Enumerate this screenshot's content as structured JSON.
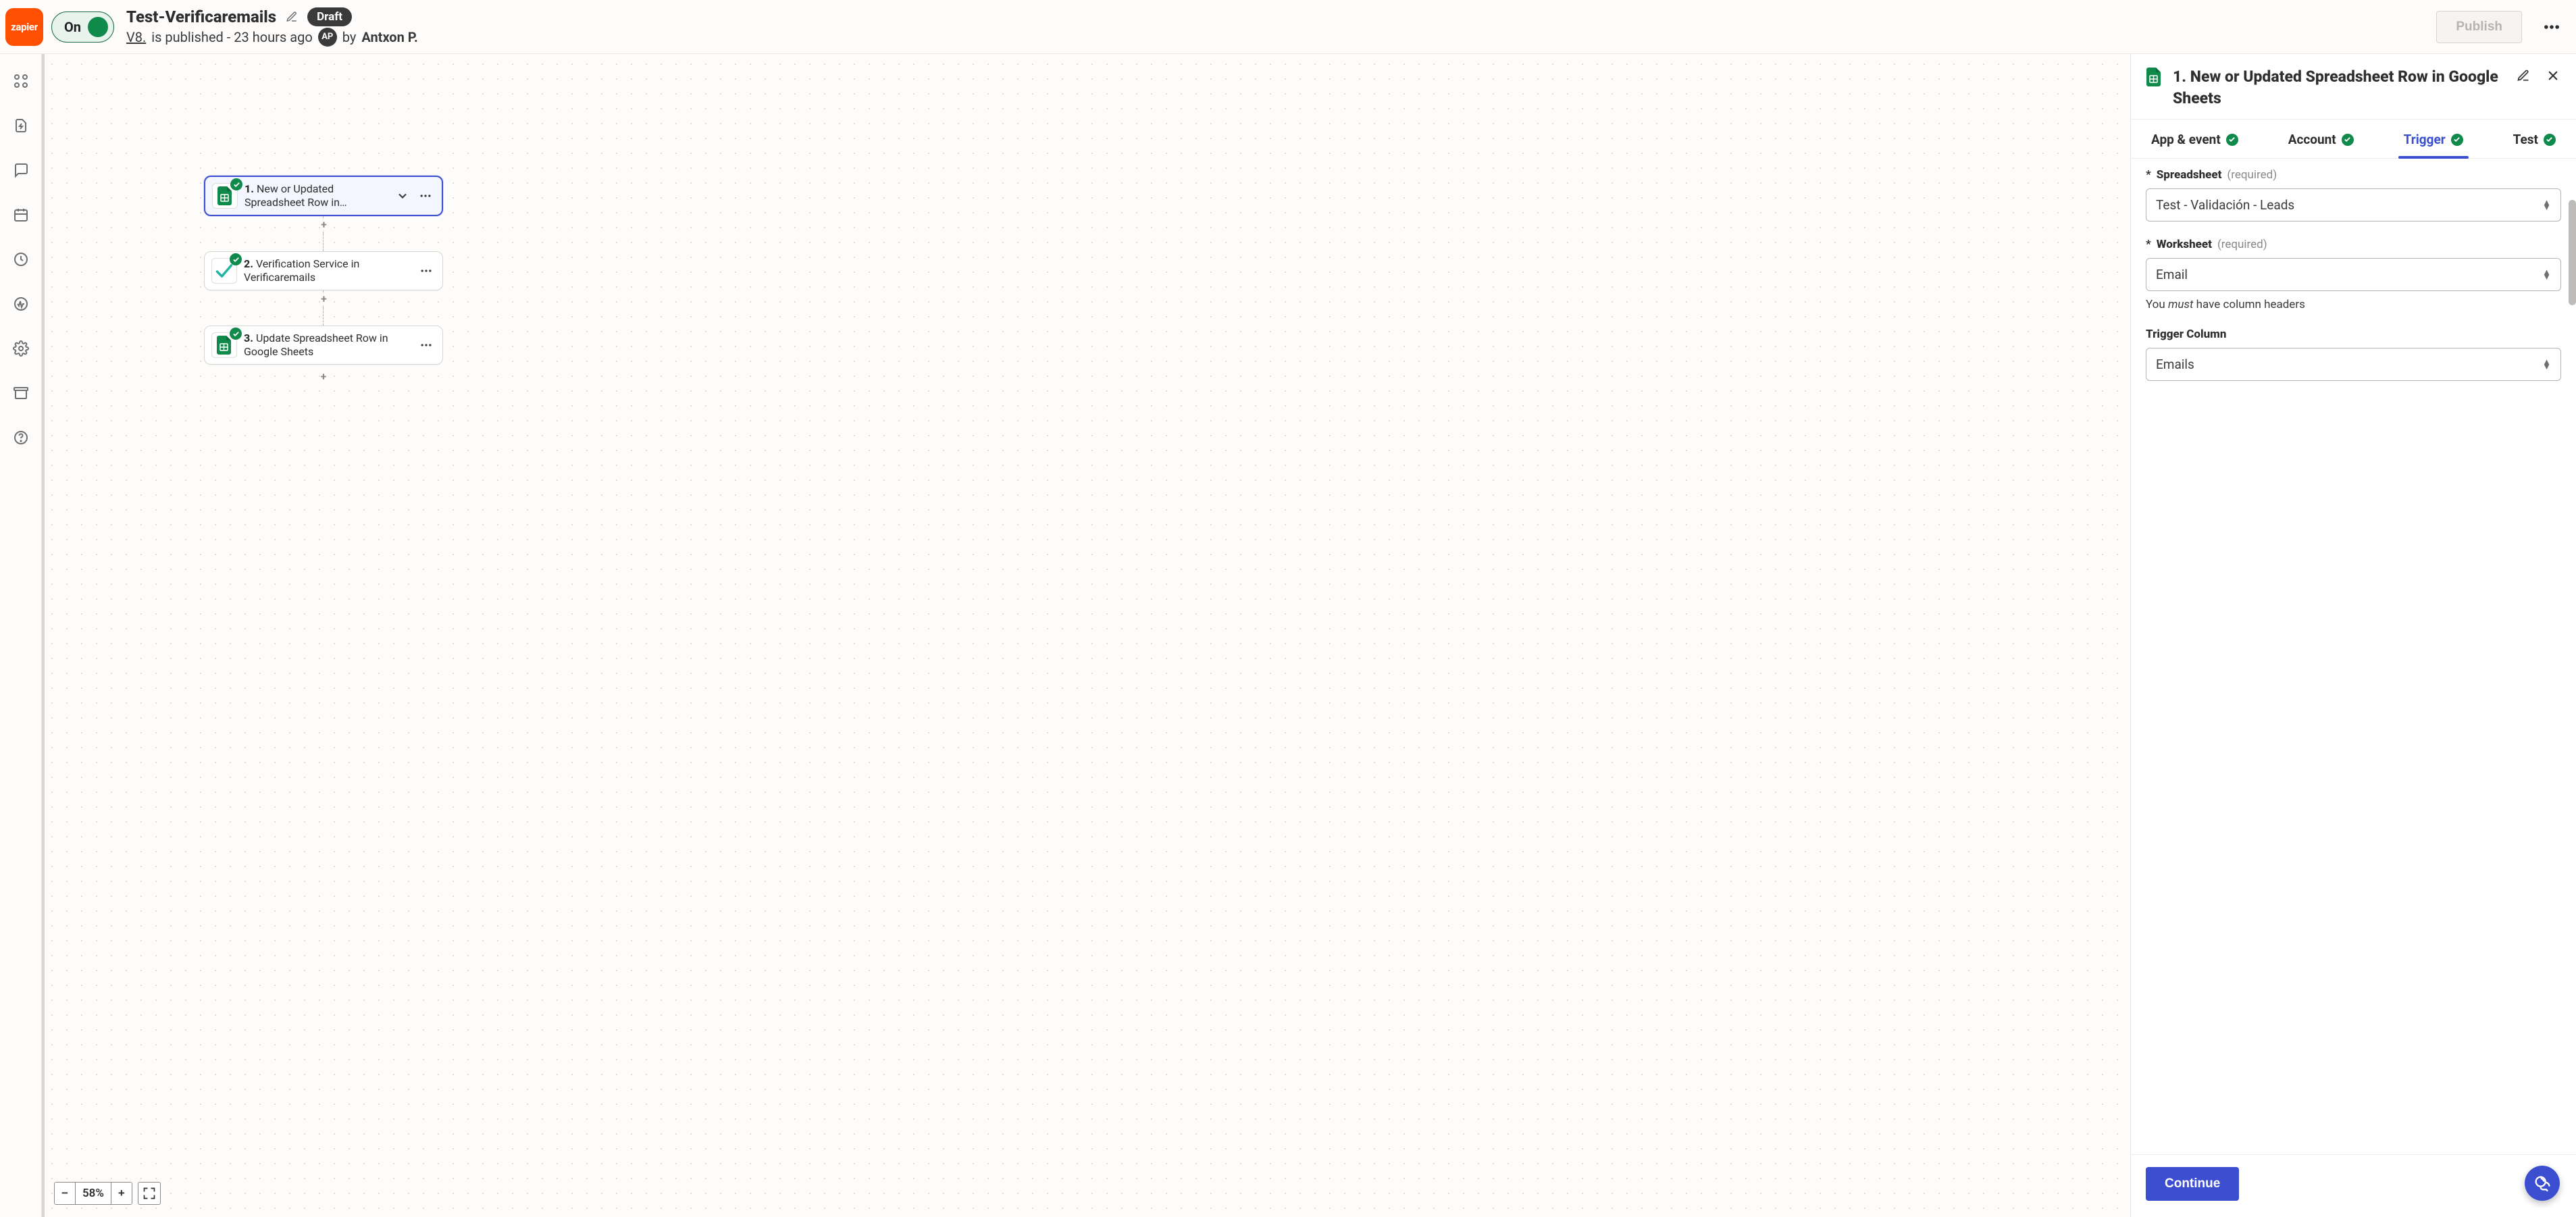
{
  "header": {
    "brand": "zapier",
    "toggle_label": "On",
    "zap_title": "Test-Verificaremails",
    "draft_label": "Draft",
    "version_text": "V8.",
    "published_text": "is published - 23 hours ago",
    "avatar_initials": "AP",
    "by_text": "by",
    "author_name": "Antxon P.",
    "publish_btn": "Publish"
  },
  "zoom": {
    "minus": "−",
    "pct": "58%",
    "plus": "+"
  },
  "steps": [
    {
      "num": "1.",
      "title": "New or Updated Spreadsheet Row in…",
      "app": "sheets",
      "selected": true
    },
    {
      "num": "2.",
      "title": "Verification Service in Verificaremails",
      "app": "verify",
      "selected": false
    },
    {
      "num": "3.",
      "title": "Update Spreadsheet Row in Google Sheets",
      "app": "sheets",
      "selected": false
    }
  ],
  "panel": {
    "title": "1. New or Updated Spreadsheet Row in Google Sheets",
    "tabs": {
      "app_event": "App & event",
      "account": "Account",
      "trigger": "Trigger",
      "test": "Test"
    },
    "fields": {
      "spreadsheet": {
        "star": "*",
        "label": "Spreadsheet",
        "req": "(required)",
        "value": "Test - Validación - Leads"
      },
      "worksheet": {
        "star": "*",
        "label": "Worksheet",
        "req": "(required)",
        "value": "Email"
      },
      "worksheet_helper_pre": "You ",
      "worksheet_helper_em": "must",
      "worksheet_helper_post": " have column headers",
      "triggercol": {
        "label": "Trigger Column",
        "value": "Emails"
      }
    },
    "continue": "Continue"
  }
}
